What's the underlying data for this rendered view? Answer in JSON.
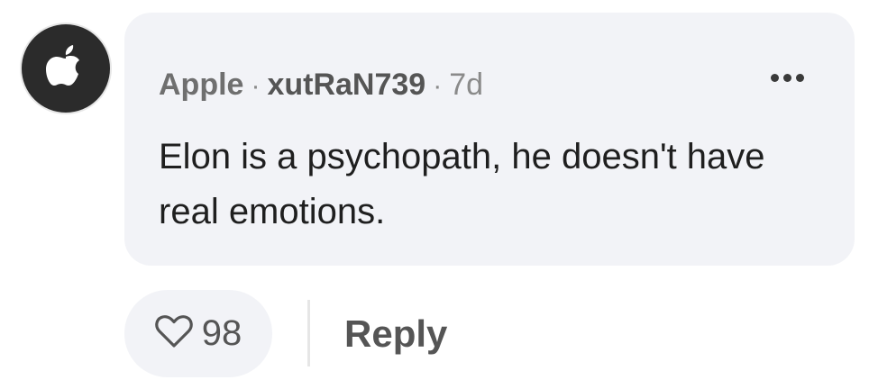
{
  "comment": {
    "avatar_icon": "apple-logo-icon",
    "author": "Apple",
    "separator": "·",
    "username": "xutRaN739",
    "time": "7d",
    "more_icon": "more-horizontal-icon",
    "text": "Elon is a psychopath, he doesn't have real emotions."
  },
  "actions": {
    "like_icon": "heart-icon",
    "like_count": "98",
    "reply_label": "Reply"
  },
  "colors": {
    "bubble": "#f2f3f7",
    "avatar": "#2b2b2b",
    "text": "#1f1f1f",
    "muted": "#8a8a8a"
  }
}
